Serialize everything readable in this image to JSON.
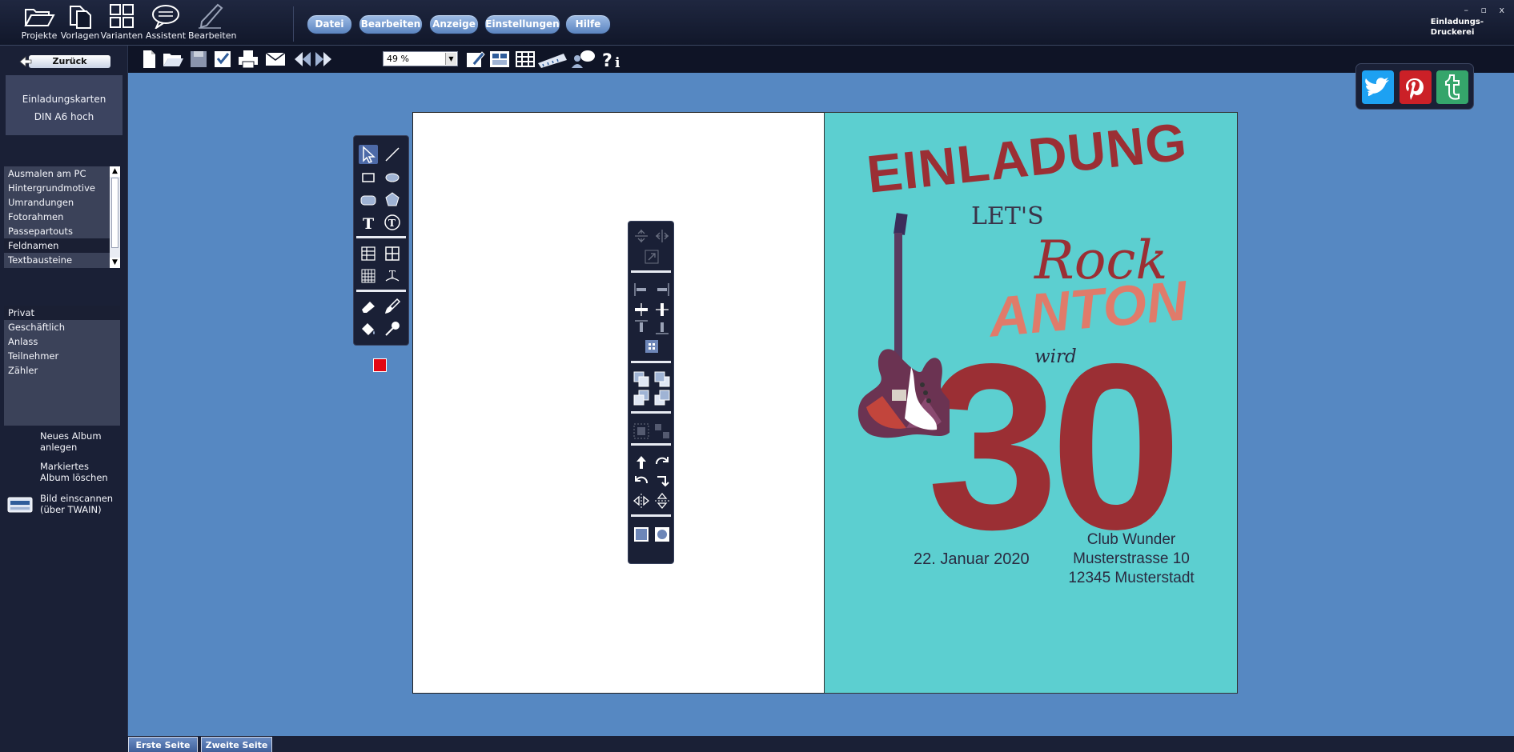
{
  "topbar": {
    "buttons": [
      {
        "label": "Projekte",
        "icon": "folder-open-icon"
      },
      {
        "label": "Vorlagen",
        "icon": "documents-icon"
      },
      {
        "label": "Varianten",
        "icon": "grid-icon"
      },
      {
        "label": "Assistent",
        "icon": "chat-bubble-icon"
      },
      {
        "label": "Bearbeiten",
        "icon": "pencil-icon"
      }
    ],
    "menu": [
      "Datei",
      "Bearbeiten",
      "Anzeige",
      "Einstellungen",
      "Hilfe"
    ],
    "brand": {
      "line1": "Einladungs-",
      "line2": "Druckerei"
    },
    "window_controls": "– ▫ x"
  },
  "left": {
    "back_label": "Zurück",
    "card": {
      "line1": "Einladungskarten",
      "line2": "DIN A6 hoch"
    },
    "categories": [
      "Ausmalen am PC",
      "Hintergrundmotive",
      "Umrandungen",
      "Fotorahmen",
      "Passepartouts",
      "Feldnamen",
      "Textbausteine"
    ],
    "selected_category": "Feldnamen",
    "fields": [
      "Privat",
      "Geschäftlich",
      "Anlass",
      "Teilnehmer",
      "Zähler"
    ],
    "actions": {
      "new_album": {
        "line1": "Neues Album",
        "line2": "anlegen"
      },
      "delete_album": {
        "line1": "Markiertes",
        "line2": "Album löschen"
      },
      "scan": {
        "line1": "Bild einscannen",
        "line2": "(über TWAIN)"
      }
    }
  },
  "toolbar": {
    "zoom": "49 %"
  },
  "design": {
    "headline": "EINLADUNG",
    "lets": "LET'S",
    "rock": "Rock",
    "name": "ANTON",
    "wird": "wird",
    "age": "30",
    "date": "22. Januar 2020",
    "address": [
      "Club Wunder",
      "Musterstrasse 10",
      "12345 Musterstadt"
    ],
    "colors": {
      "background": "#5ccfd0",
      "red": "#9b2f34",
      "salmon": "#e07b6a",
      "dark": "#2a2a40"
    }
  },
  "tabs": [
    "Erste Seite",
    "Zweite Seite"
  ]
}
